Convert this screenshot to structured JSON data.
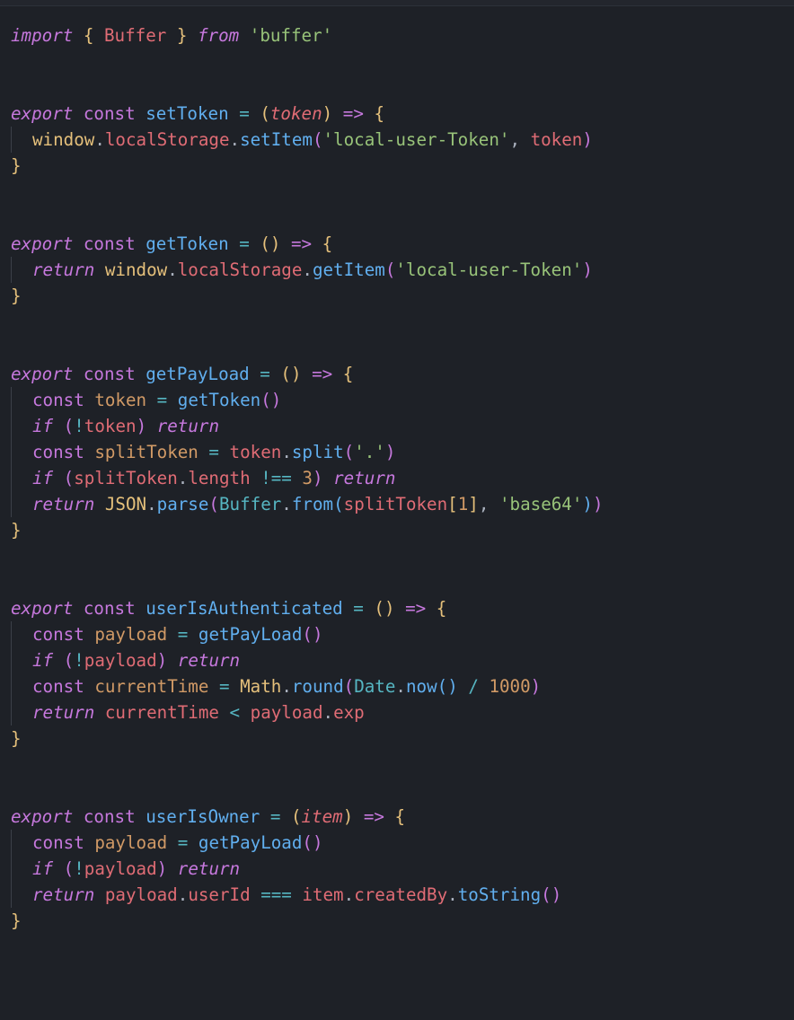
{
  "colors": {
    "background": "#1e2127",
    "foreground": "#abb2bf",
    "keyword": "#c678dd",
    "string": "#98c379",
    "function": "#61afef",
    "variable": "#e5c07b",
    "parameter": "#e06c75",
    "property": "#e06c75",
    "constant": "#d19a66",
    "builtin": "#56b6c2",
    "number": "#d19a66"
  },
  "code": {
    "import_kw": "import",
    "from_kw": "from",
    "buffer": "Buffer",
    "buffer_mod": "'buffer'",
    "export_kw": "export",
    "const_kw": "const",
    "return_kw": "return",
    "if_kw": "if",
    "arrow": "=>",
    "eq": "=",
    "neq": "!==",
    "seq": "===",
    "lt": "<",
    "not": "!",
    "div": "/",
    "setToken": {
      "name": "setToken",
      "param": "token",
      "window": "window",
      "localStorage": "localStorage",
      "setItem": "setItem",
      "key": "'local-user-Token'",
      "arg2": "token"
    },
    "getToken": {
      "name": "getToken",
      "window": "window",
      "localStorage": "localStorage",
      "getItem": "getItem",
      "key": "'local-user-Token'"
    },
    "getPayLoad": {
      "name": "getPayLoad",
      "token": "token",
      "getTokenCall": "getToken",
      "splitToken": "splitToken",
      "split": "split",
      "dot": "'.'",
      "length": "length",
      "three": "3",
      "json": "JSON",
      "parse": "parse",
      "bufferCls": "Buffer",
      "from": "from",
      "one": "1",
      "base64": "'base64'"
    },
    "userIsAuthenticated": {
      "name": "userIsAuthenticated",
      "payload": "payload",
      "getPayLoadCall": "getPayLoad",
      "currentTime": "currentTime",
      "math": "Math",
      "round": "round",
      "date": "Date",
      "now": "now",
      "thousand": "1000",
      "exp": "exp"
    },
    "userIsOwner": {
      "name": "userIsOwner",
      "param": "item",
      "payload": "payload",
      "getPayLoadCall": "getPayLoad",
      "userId": "userId",
      "item": "item",
      "createdBy": "createdBy",
      "toString": "toString"
    }
  }
}
